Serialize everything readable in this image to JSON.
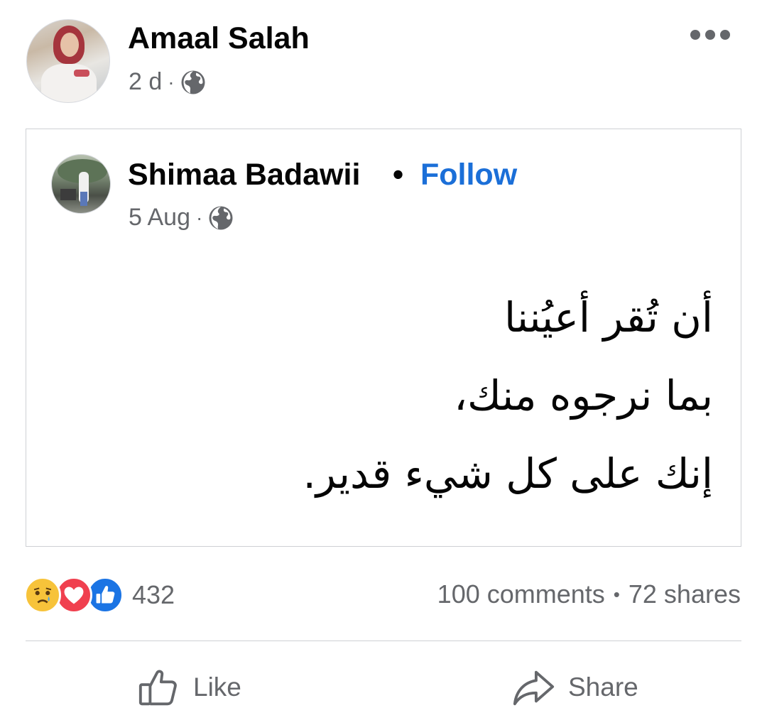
{
  "post": {
    "author_name": "Amaal Salah",
    "time": "2 d",
    "visibility_icon": "globe-icon",
    "more_icon": "more-horizontal-icon"
  },
  "shared_post": {
    "author_name": "Shimaa Badawii",
    "separator": "•",
    "follow_label": "Follow",
    "time": "5 Aug",
    "visibility_icon": "globe-icon",
    "text_lines": [
      "أن تُقر أعيُننا",
      "بما نرجوه منك،",
      "إنك على كل شيء قدير."
    ]
  },
  "engagement": {
    "reaction_icons": [
      "sad-reaction-icon",
      "love-reaction-icon",
      "like-reaction-icon"
    ],
    "reaction_count": "432",
    "comments": "100 comments",
    "separator": "•",
    "shares": "72 shares"
  },
  "actions": {
    "like_label": "Like",
    "share_label": "Share"
  },
  "colors": {
    "follow": "#1b6fd8",
    "secondary_text": "#65676b",
    "border": "#ced0d4"
  },
  "meta_separator": "·"
}
